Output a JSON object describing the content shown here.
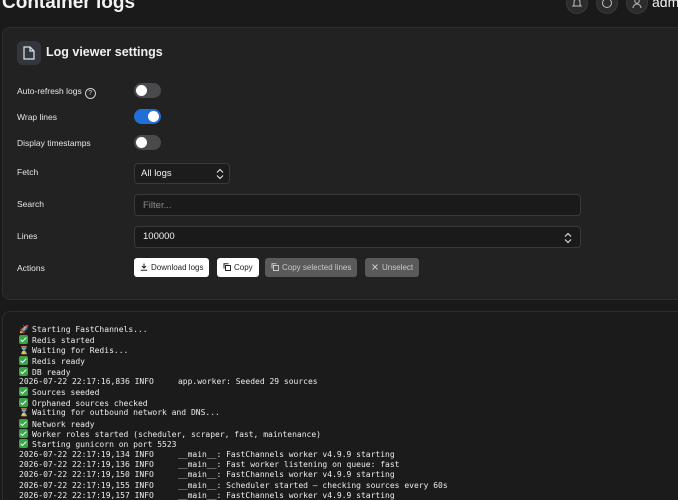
{
  "header": {
    "title": "Container logs",
    "user_name": "admi"
  },
  "settings": {
    "title": "Log viewer settings",
    "auto_refresh": {
      "label": "Auto-refresh logs",
      "help": "?",
      "on": false
    },
    "wrap_lines": {
      "label": "Wrap lines",
      "on": true
    },
    "timestamps": {
      "label": "Display timestamps",
      "on": false
    },
    "fetch": {
      "label": "Fetch",
      "value": "All logs"
    },
    "search": {
      "label": "Search",
      "placeholder": "Filter..."
    },
    "lines": {
      "label": "Lines",
      "value": "100000"
    },
    "actions": {
      "label": "Actions",
      "download": "Download logs",
      "copy": "Copy",
      "copy_selected": "Copy selected lines",
      "unselect": "Unselect"
    }
  },
  "logs": [
    {
      "icon": "rocket",
      "text": "Starting FastChannels..."
    },
    {
      "icon": "check",
      "text": "Redis started"
    },
    {
      "icon": "hourglass",
      "text": "Waiting for Redis..."
    },
    {
      "icon": "check",
      "text": "Redis ready"
    },
    {
      "icon": "box-check",
      "text": "DB ready"
    },
    {
      "icon": "",
      "text": "2026-07-22 22:17:16,836 INFO     app.worker: Seeded 29 sources"
    },
    {
      "icon": "check",
      "text": "Sources seeded"
    },
    {
      "icon": "check",
      "text": "Orphaned sources checked"
    },
    {
      "icon": "hourglass",
      "text": "Waiting for outbound network and DNS..."
    },
    {
      "icon": "check",
      "text": "Network ready"
    },
    {
      "icon": "check",
      "text": "Worker roles started (scheduler, scraper, fast, maintenance)"
    },
    {
      "icon": "check",
      "text": "Starting gunicorn on port 5523"
    },
    {
      "icon": "",
      "text": "2026-07-22 22:17:19,134 INFO     __main__: FastChannels worker v4.9.9 starting"
    },
    {
      "icon": "",
      "text": "2026-07-22 22:17:19,136 INFO     __main__: Fast worker listening on queue: fast"
    },
    {
      "icon": "",
      "text": "2026-07-22 22:17:19,150 INFO     __main__: FastChannels worker v4.9.9 starting"
    },
    {
      "icon": "",
      "text": "2026-07-22 22:17:19,155 INFO     __main__: Scheduler started — checking sources every 60s"
    },
    {
      "icon": "",
      "text": "2026-07-22 22:17:19,157 INFO     __main__: FastChannels worker v4.9.9 starting"
    }
  ]
}
